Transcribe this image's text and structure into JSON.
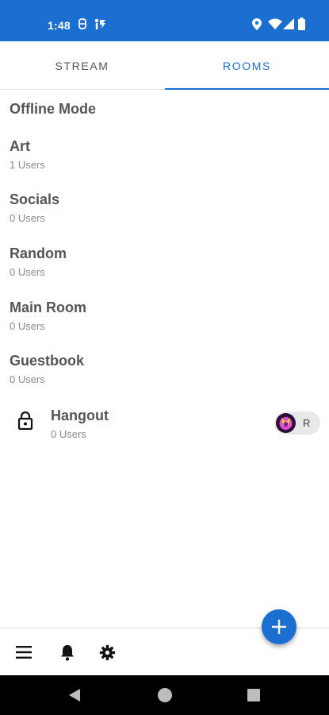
{
  "status_bar": {
    "time": "1:48",
    "icons": [
      "sync-icon",
      "accessibility-icon",
      "location-icon",
      "wifi-icon",
      "signal-icon",
      "battery-icon"
    ],
    "background": "#1a6fd0"
  },
  "tabs": [
    {
      "label": "STREAM",
      "selected": false
    },
    {
      "label": "ROOMS",
      "selected": true
    }
  ],
  "accent_color": "#1a6fd0",
  "offline_mode_label": "Offline Mode",
  "rooms": [
    {
      "name": "Art",
      "users": "1 Users"
    },
    {
      "name": "Socials",
      "users": "0 Users"
    },
    {
      "name": "Random",
      "users": "0 Users"
    },
    {
      "name": "Main Room",
      "users": "0 Users"
    },
    {
      "name": "Guestbook",
      "users": "0 Users"
    }
  ],
  "locked_room": {
    "name": "Hangout",
    "users": "0 Users",
    "icon": "lock-icon",
    "chip_label": "R"
  },
  "bottom_bar": {
    "icons": [
      "menu-icon",
      "bell-icon",
      "gear-icon"
    ]
  },
  "fab_icon": "plus-icon",
  "nav_bar": {
    "icons": [
      "back-icon",
      "home-icon",
      "recents-icon"
    ]
  }
}
